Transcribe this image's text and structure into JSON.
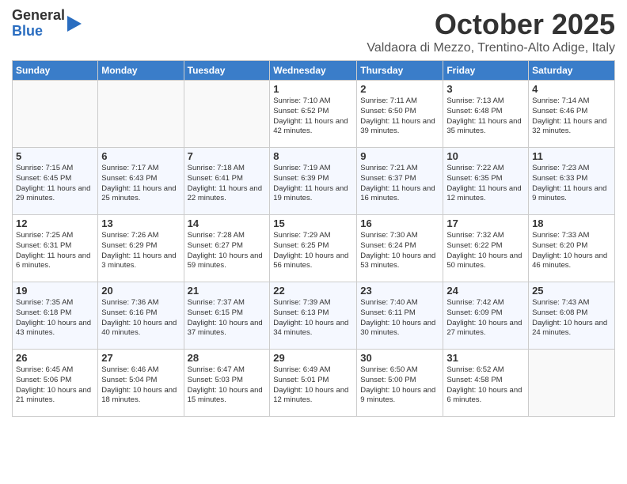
{
  "header": {
    "logo_general": "General",
    "logo_blue": "Blue",
    "month": "October 2025",
    "location": "Valdaora di Mezzo, Trentino-Alto Adige, Italy"
  },
  "days_of_week": [
    "Sunday",
    "Monday",
    "Tuesday",
    "Wednesday",
    "Thursday",
    "Friday",
    "Saturday"
  ],
  "weeks": [
    [
      {
        "day": "",
        "info": ""
      },
      {
        "day": "",
        "info": ""
      },
      {
        "day": "",
        "info": ""
      },
      {
        "day": "1",
        "info": "Sunrise: 7:10 AM\nSunset: 6:52 PM\nDaylight: 11 hours and 42 minutes."
      },
      {
        "day": "2",
        "info": "Sunrise: 7:11 AM\nSunset: 6:50 PM\nDaylight: 11 hours and 39 minutes."
      },
      {
        "day": "3",
        "info": "Sunrise: 7:13 AM\nSunset: 6:48 PM\nDaylight: 11 hours and 35 minutes."
      },
      {
        "day": "4",
        "info": "Sunrise: 7:14 AM\nSunset: 6:46 PM\nDaylight: 11 hours and 32 minutes."
      }
    ],
    [
      {
        "day": "5",
        "info": "Sunrise: 7:15 AM\nSunset: 6:45 PM\nDaylight: 11 hours and 29 minutes."
      },
      {
        "day": "6",
        "info": "Sunrise: 7:17 AM\nSunset: 6:43 PM\nDaylight: 11 hours and 25 minutes."
      },
      {
        "day": "7",
        "info": "Sunrise: 7:18 AM\nSunset: 6:41 PM\nDaylight: 11 hours and 22 minutes."
      },
      {
        "day": "8",
        "info": "Sunrise: 7:19 AM\nSunset: 6:39 PM\nDaylight: 11 hours and 19 minutes."
      },
      {
        "day": "9",
        "info": "Sunrise: 7:21 AM\nSunset: 6:37 PM\nDaylight: 11 hours and 16 minutes."
      },
      {
        "day": "10",
        "info": "Sunrise: 7:22 AM\nSunset: 6:35 PM\nDaylight: 11 hours and 12 minutes."
      },
      {
        "day": "11",
        "info": "Sunrise: 7:23 AM\nSunset: 6:33 PM\nDaylight: 11 hours and 9 minutes."
      }
    ],
    [
      {
        "day": "12",
        "info": "Sunrise: 7:25 AM\nSunset: 6:31 PM\nDaylight: 11 hours and 6 minutes."
      },
      {
        "day": "13",
        "info": "Sunrise: 7:26 AM\nSunset: 6:29 PM\nDaylight: 11 hours and 3 minutes."
      },
      {
        "day": "14",
        "info": "Sunrise: 7:28 AM\nSunset: 6:27 PM\nDaylight: 10 hours and 59 minutes."
      },
      {
        "day": "15",
        "info": "Sunrise: 7:29 AM\nSunset: 6:25 PM\nDaylight: 10 hours and 56 minutes."
      },
      {
        "day": "16",
        "info": "Sunrise: 7:30 AM\nSunset: 6:24 PM\nDaylight: 10 hours and 53 minutes."
      },
      {
        "day": "17",
        "info": "Sunrise: 7:32 AM\nSunset: 6:22 PM\nDaylight: 10 hours and 50 minutes."
      },
      {
        "day": "18",
        "info": "Sunrise: 7:33 AM\nSunset: 6:20 PM\nDaylight: 10 hours and 46 minutes."
      }
    ],
    [
      {
        "day": "19",
        "info": "Sunrise: 7:35 AM\nSunset: 6:18 PM\nDaylight: 10 hours and 43 minutes."
      },
      {
        "day": "20",
        "info": "Sunrise: 7:36 AM\nSunset: 6:16 PM\nDaylight: 10 hours and 40 minutes."
      },
      {
        "day": "21",
        "info": "Sunrise: 7:37 AM\nSunset: 6:15 PM\nDaylight: 10 hours and 37 minutes."
      },
      {
        "day": "22",
        "info": "Sunrise: 7:39 AM\nSunset: 6:13 PM\nDaylight: 10 hours and 34 minutes."
      },
      {
        "day": "23",
        "info": "Sunrise: 7:40 AM\nSunset: 6:11 PM\nDaylight: 10 hours and 30 minutes."
      },
      {
        "day": "24",
        "info": "Sunrise: 7:42 AM\nSunset: 6:09 PM\nDaylight: 10 hours and 27 minutes."
      },
      {
        "day": "25",
        "info": "Sunrise: 7:43 AM\nSunset: 6:08 PM\nDaylight: 10 hours and 24 minutes."
      }
    ],
    [
      {
        "day": "26",
        "info": "Sunrise: 6:45 AM\nSunset: 5:06 PM\nDaylight: 10 hours and 21 minutes."
      },
      {
        "day": "27",
        "info": "Sunrise: 6:46 AM\nSunset: 5:04 PM\nDaylight: 10 hours and 18 minutes."
      },
      {
        "day": "28",
        "info": "Sunrise: 6:47 AM\nSunset: 5:03 PM\nDaylight: 10 hours and 15 minutes."
      },
      {
        "day": "29",
        "info": "Sunrise: 6:49 AM\nSunset: 5:01 PM\nDaylight: 10 hours and 12 minutes."
      },
      {
        "day": "30",
        "info": "Sunrise: 6:50 AM\nSunset: 5:00 PM\nDaylight: 10 hours and 9 minutes."
      },
      {
        "day": "31",
        "info": "Sunrise: 6:52 AM\nSunset: 4:58 PM\nDaylight: 10 hours and 6 minutes."
      },
      {
        "day": "",
        "info": ""
      }
    ]
  ]
}
